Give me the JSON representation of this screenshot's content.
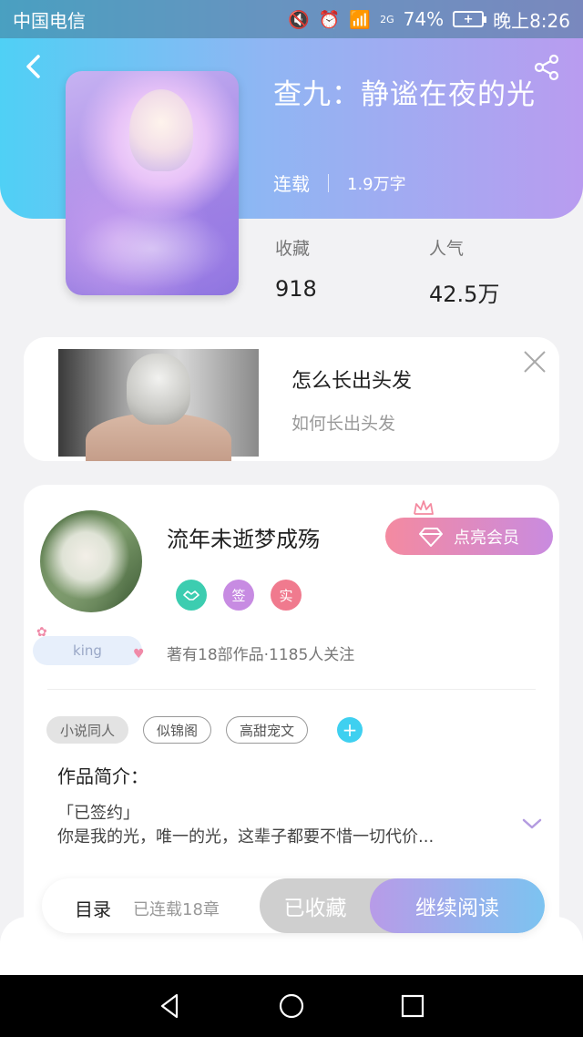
{
  "status_bar": {
    "carrier": "中国电信",
    "network": "2G",
    "battery_percent": "74%",
    "time": "晚上8:26"
  },
  "book": {
    "title": "查九：静谧在夜的光",
    "status": "连载",
    "word_count": "1.9万字",
    "favorites_label": "收藏",
    "favorites_value": "918",
    "popularity_label": "人气",
    "popularity_value": "42.5万"
  },
  "ad": {
    "title": "怎么长出头发",
    "subtitle": "如何长出头发"
  },
  "author": {
    "name": "流年未逝梦成殇",
    "vip_button": "点亮会员",
    "badges": [
      "签",
      "实"
    ],
    "tag": "king",
    "stats": "著有18部作品·1185人关注"
  },
  "tags": [
    "小说同人",
    "似锦阁",
    "高甜宠文"
  ],
  "intro": {
    "label": "作品简介：",
    "status": "「已签约」",
    "text": "你是我的光，唯一的光，这辈子都要不惜一切代价..."
  },
  "action_bar": {
    "catalog": "目录",
    "serial_count": "已连载18章",
    "favorited": "已收藏",
    "continue_reading": "继续阅读"
  },
  "colors": {
    "accent_cyan": "#4fd0f5",
    "accent_purple": "#b99cf0",
    "vip_pink": "#f48aa0"
  }
}
